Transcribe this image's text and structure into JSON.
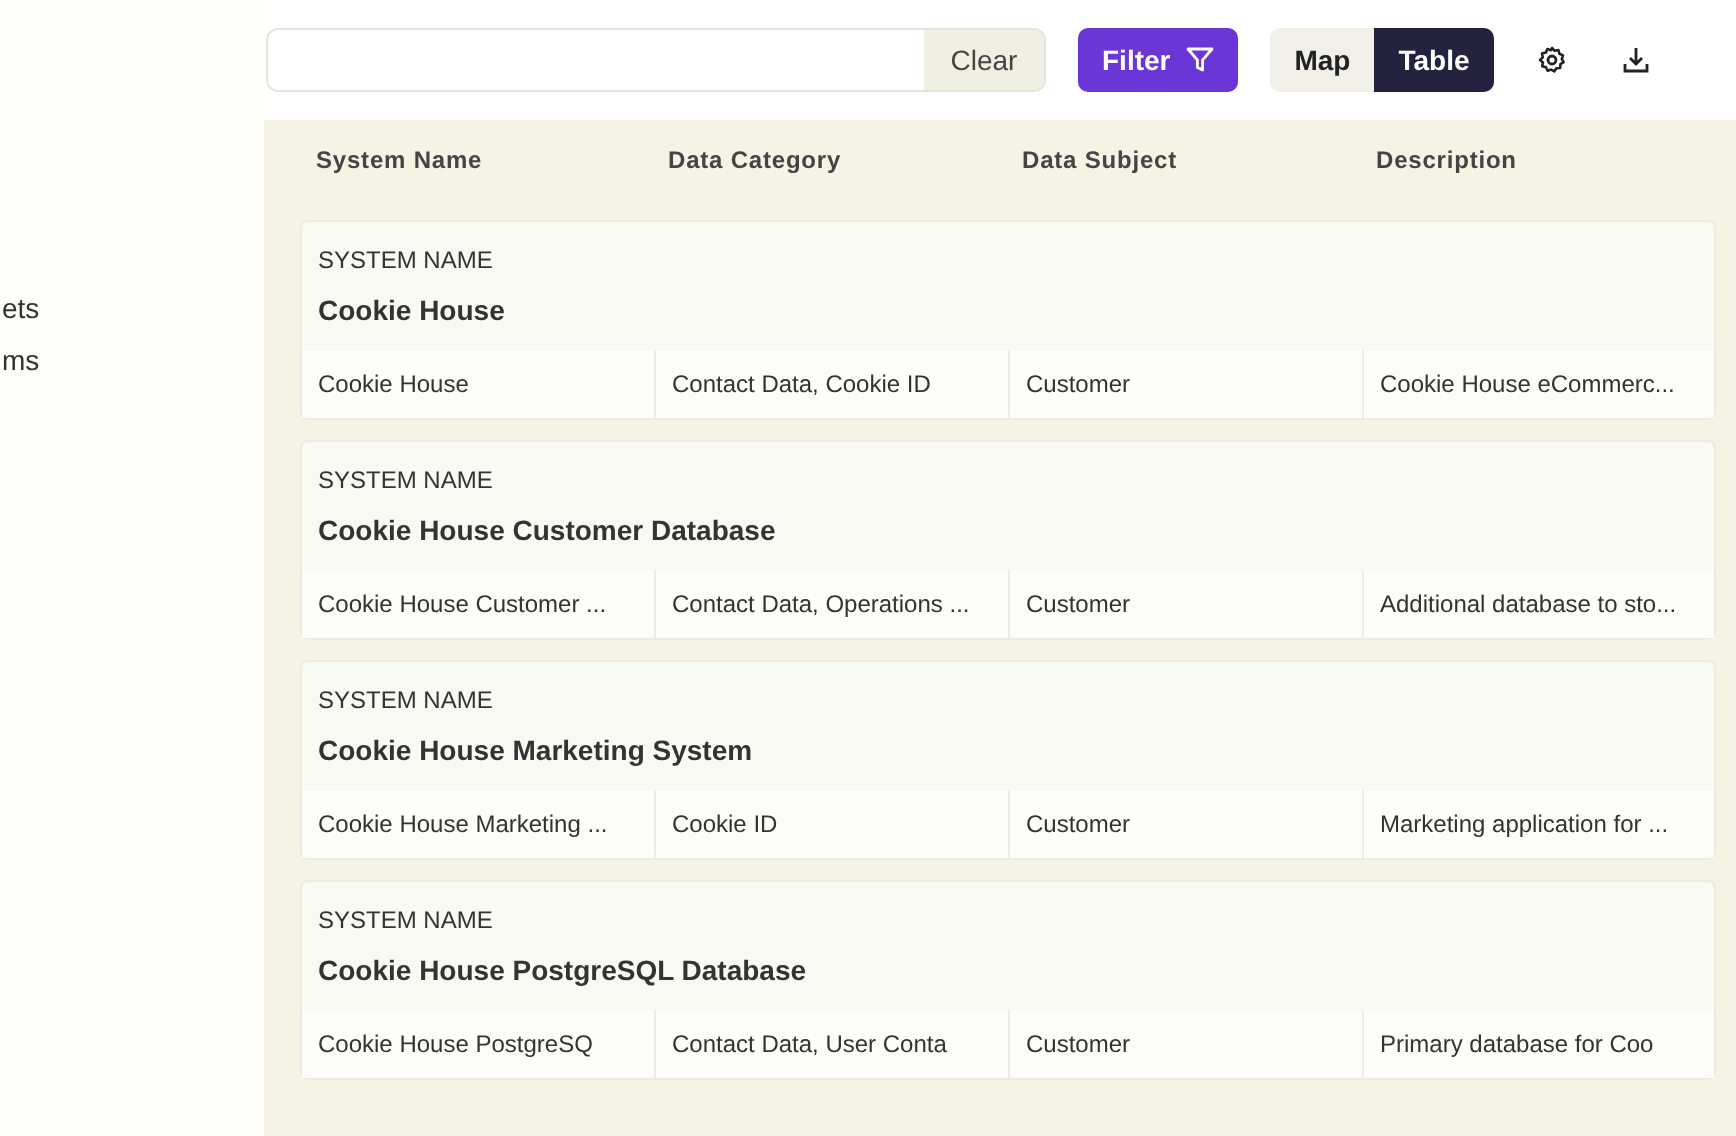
{
  "sidebar": {
    "items": [
      {
        "label": "ets"
      },
      {
        "label": "ms"
      }
    ]
  },
  "toolbar": {
    "clear_label": "Clear",
    "filter_label": "Filter",
    "view_toggle": [
      {
        "label": "Map",
        "selected": false
      },
      {
        "label": "Table",
        "selected": true
      }
    ]
  },
  "table": {
    "columns": [
      "System Name",
      "Data Category",
      "Data Subject",
      "Description"
    ],
    "groups": [
      {
        "group_label": "SYSTEM NAME",
        "title": "Cookie House",
        "cells": [
          "Cookie House",
          "Contact Data, Cookie ID",
          "Customer",
          "Cookie House eCommerc..."
        ]
      },
      {
        "group_label": "SYSTEM NAME",
        "title": "Cookie House Customer Database",
        "cells": [
          "Cookie House Customer ...",
          "Contact Data, Operations ...",
          "Customer",
          "Additional database to sto..."
        ]
      },
      {
        "group_label": "SYSTEM NAME",
        "title": "Cookie House Marketing System",
        "cells": [
          "Cookie House Marketing ...",
          "Cookie ID",
          "Customer",
          "Marketing application for ..."
        ]
      },
      {
        "group_label": "SYSTEM NAME",
        "title": "Cookie House PostgreSQL Database",
        "cells": [
          "Cookie House PostgreSQ",
          "Contact Data, User Conta",
          "Customer",
          "Primary database for Coo"
        ]
      }
    ]
  }
}
